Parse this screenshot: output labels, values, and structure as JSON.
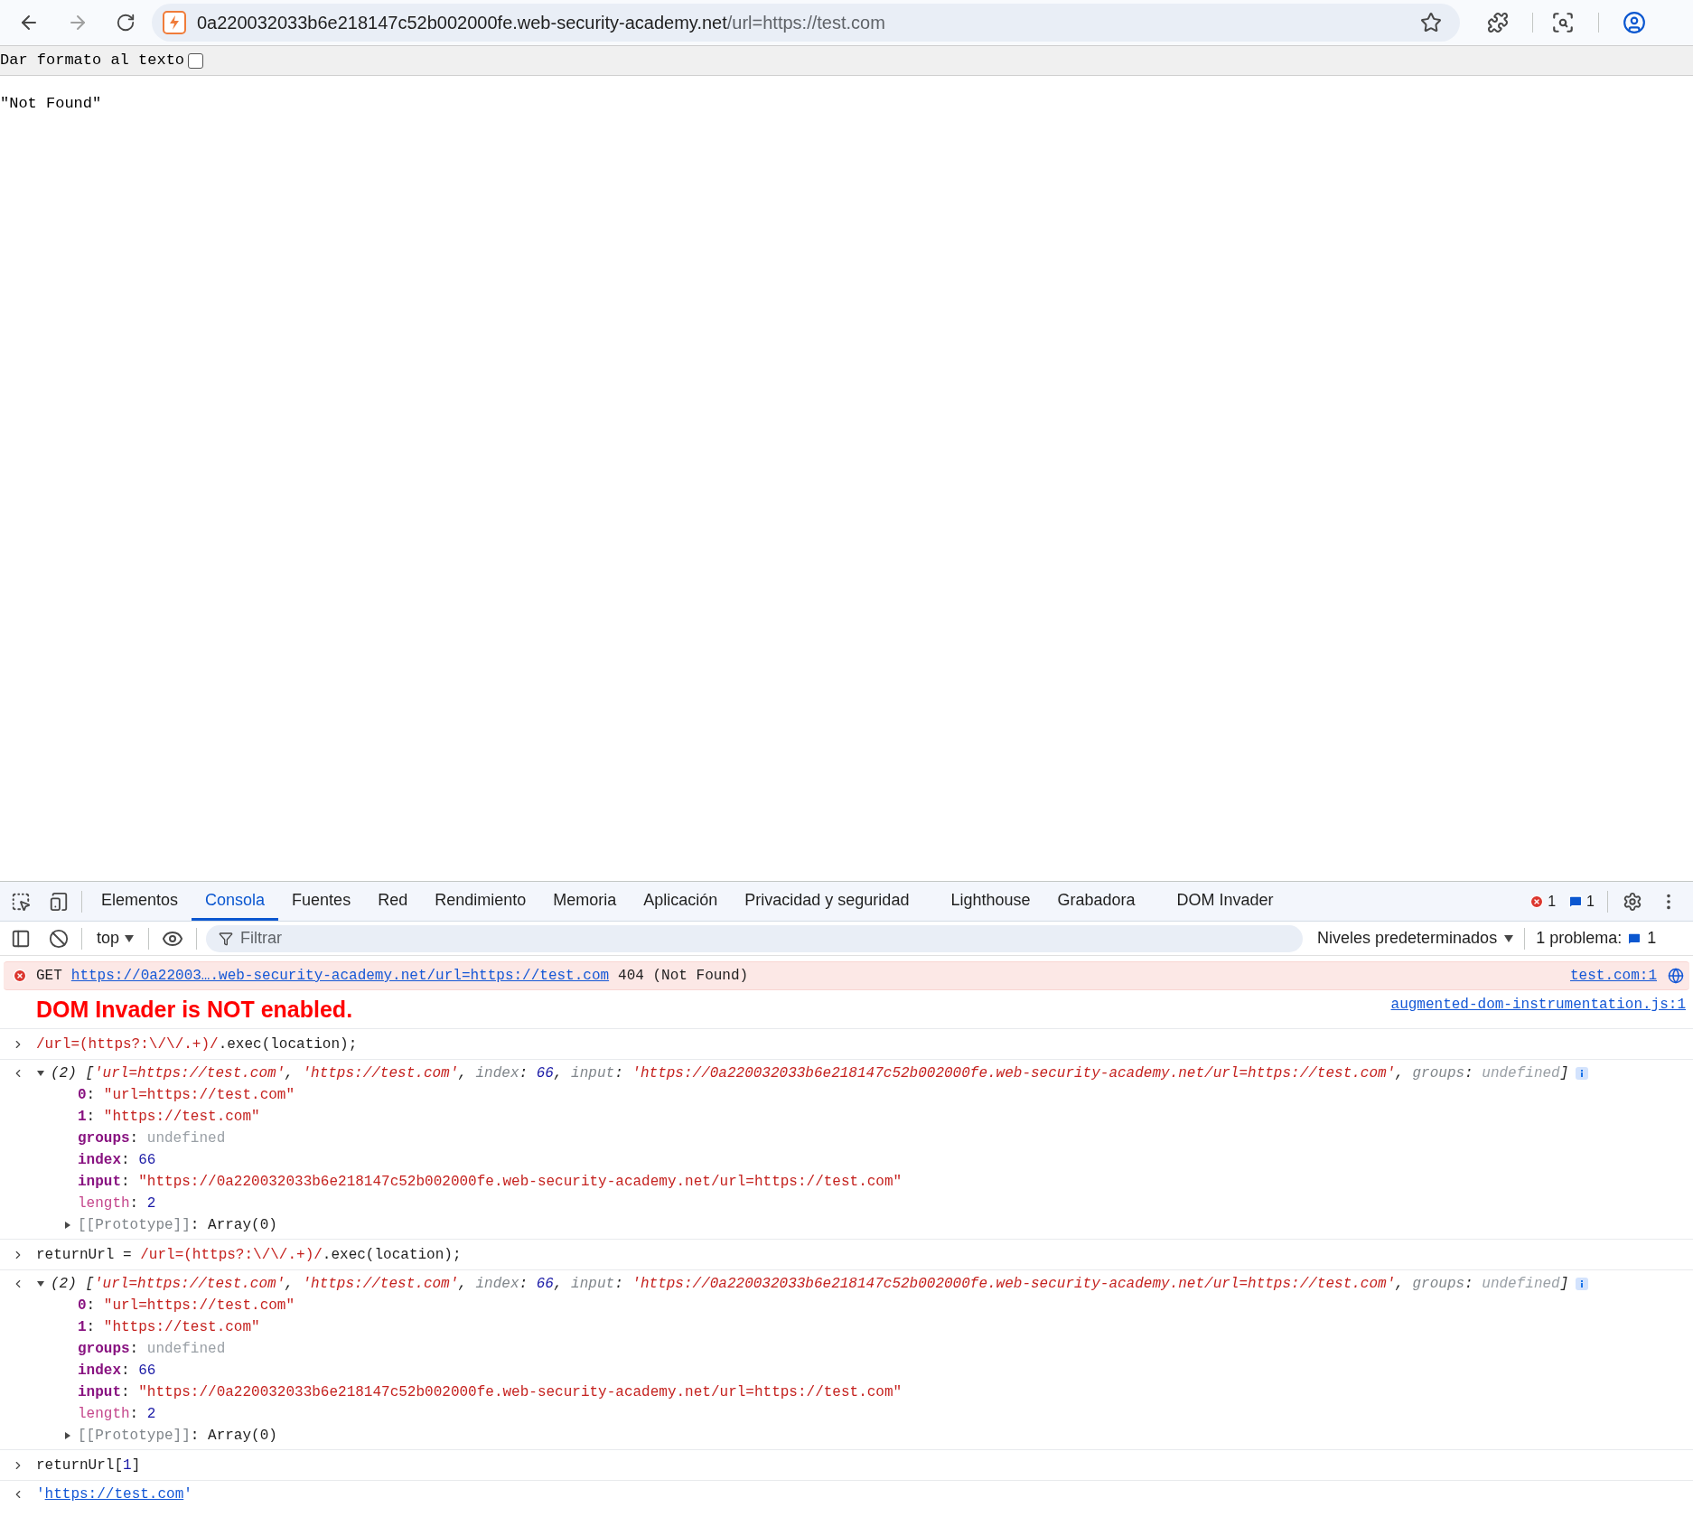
{
  "browser": {
    "url_host": "0a220032033b6e218147c52b002000fe.web-security-academy.net",
    "url_path": "/url=https://test.com"
  },
  "page": {
    "format_label": "Dar formato al texto",
    "format_checked": false,
    "body": "\"Not Found\""
  },
  "devtools": {
    "tabs": [
      {
        "label": "Elementos",
        "selected": false
      },
      {
        "label": "Consola",
        "selected": true
      },
      {
        "label": "Fuentes",
        "selected": false
      },
      {
        "label": "Red",
        "selected": false
      },
      {
        "label": "Rendimiento",
        "selected": false
      },
      {
        "label": "Memoria",
        "selected": false
      },
      {
        "label": "Aplicación",
        "selected": false
      },
      {
        "label": "Privacidad y seguridad",
        "selected": false
      },
      {
        "label": "Lighthouse",
        "selected": false
      },
      {
        "label": "Grabadora",
        "selected": false
      },
      {
        "label": "DOM Invader",
        "selected": false
      }
    ],
    "error_count": "1",
    "message_count": "1",
    "context": "top",
    "filter_placeholder": "Filtrar",
    "levels": "Niveles predeterminados",
    "issues_label": "1 problema:",
    "issues_count": "1"
  },
  "console": {
    "entries": [
      {
        "kind": "error",
        "method": "GET",
        "url": "https://0a22003….web-security-academy.net/url=https://test.com",
        "status": "404 (Not Found)",
        "source": "test.com:1"
      },
      {
        "kind": "styled_log",
        "text": "DOM Invader is NOT enabled.",
        "source": "augmented-dom-instrumentation.js:1"
      },
      {
        "kind": "input",
        "tokens": [
          {
            "kind": "regex",
            "s": "/url=(https?:\\/\\/.+)/"
          },
          {
            "kind": "plain",
            "s": ".exec(location);"
          }
        ]
      },
      {
        "kind": "array_result",
        "expanded": true,
        "summary": [
          {
            "kind": "plain",
            "s": "(2) ["
          },
          {
            "kind": "string",
            "s": "'url=https://test.com'"
          },
          {
            "kind": "plain",
            "s": ", "
          },
          {
            "kind": "string",
            "s": "'https://test.com'"
          },
          {
            "kind": "plain",
            "s": ", "
          },
          {
            "kind": "dim",
            "s": "index"
          },
          {
            "kind": "plain",
            "s": ": "
          },
          {
            "kind": "number",
            "s": "66"
          },
          {
            "kind": "plain",
            "s": ", "
          },
          {
            "kind": "dim",
            "s": "input"
          },
          {
            "kind": "plain",
            "s": ": "
          },
          {
            "kind": "string",
            "s": "'https://0a220032033b6e218147c52b002000fe.web-security-academy.net/url=https://test.com'"
          },
          {
            "kind": "plain",
            "s": ", "
          },
          {
            "kind": "dim",
            "s": "groups"
          },
          {
            "kind": "plain",
            "s": ": "
          },
          {
            "kind": "undef",
            "s": "undefined"
          },
          {
            "kind": "plain",
            "s": "]"
          }
        ],
        "properties": [
          [
            {
              "kind": "key",
              "s": "0"
            },
            {
              "kind": "plain",
              "s": ": "
            },
            {
              "kind": "string",
              "s": "\"url=https://test.com\""
            }
          ],
          [
            {
              "kind": "key",
              "s": "1"
            },
            {
              "kind": "plain",
              "s": ": "
            },
            {
              "kind": "string",
              "s": "\"https://test.com\""
            }
          ],
          [
            {
              "kind": "key",
              "s": "groups"
            },
            {
              "kind": "plain",
              "s": ": "
            },
            {
              "kind": "undef",
              "s": "undefined"
            }
          ],
          [
            {
              "kind": "key",
              "s": "index"
            },
            {
              "kind": "plain",
              "s": ": "
            },
            {
              "kind": "number",
              "s": "66"
            }
          ],
          [
            {
              "kind": "key",
              "s": "input"
            },
            {
              "kind": "plain",
              "s": ": "
            },
            {
              "kind": "string",
              "s": "\"https://0a220032033b6e218147c52b002000fe.web-security-academy.net/url=https://test.com\""
            }
          ],
          [
            {
              "kind": "hidden_key",
              "s": "length"
            },
            {
              "kind": "plain",
              "s": ": "
            },
            {
              "kind": "number",
              "s": "2"
            }
          ]
        ],
        "prototype": {
          "expanded": false,
          "tokens": [
            {
              "kind": "dim",
              "s": "[[Prototype]]"
            },
            {
              "kind": "plain",
              "s": ": Array(0)"
            }
          ]
        }
      },
      {
        "kind": "input",
        "tokens": [
          {
            "kind": "plain",
            "s": "returnUrl = "
          },
          {
            "kind": "regex",
            "s": "/url=(https?:\\/\\/.+)/"
          },
          {
            "kind": "plain",
            "s": ".exec(location);"
          }
        ]
      },
      {
        "kind": "array_result",
        "expanded": true,
        "summary": [
          {
            "kind": "plain",
            "s": "(2) ["
          },
          {
            "kind": "string",
            "s": "'url=https://test.com'"
          },
          {
            "kind": "plain",
            "s": ", "
          },
          {
            "kind": "string",
            "s": "'https://test.com'"
          },
          {
            "kind": "plain",
            "s": ", "
          },
          {
            "kind": "dim",
            "s": "index"
          },
          {
            "kind": "plain",
            "s": ": "
          },
          {
            "kind": "number",
            "s": "66"
          },
          {
            "kind": "plain",
            "s": ", "
          },
          {
            "kind": "dim",
            "s": "input"
          },
          {
            "kind": "plain",
            "s": ": "
          },
          {
            "kind": "string",
            "s": "'https://0a220032033b6e218147c52b002000fe.web-security-academy.net/url=https://test.com'"
          },
          {
            "kind": "plain",
            "s": ", "
          },
          {
            "kind": "dim",
            "s": "groups"
          },
          {
            "kind": "plain",
            "s": ": "
          },
          {
            "kind": "undef",
            "s": "undefined"
          },
          {
            "kind": "plain",
            "s": "]"
          }
        ],
        "properties": [
          [
            {
              "kind": "key",
              "s": "0"
            },
            {
              "kind": "plain",
              "s": ": "
            },
            {
              "kind": "string",
              "s": "\"url=https://test.com\""
            }
          ],
          [
            {
              "kind": "key",
              "s": "1"
            },
            {
              "kind": "plain",
              "s": ": "
            },
            {
              "kind": "string",
              "s": "\"https://test.com\""
            }
          ],
          [
            {
              "kind": "key",
              "s": "groups"
            },
            {
              "kind": "plain",
              "s": ": "
            },
            {
              "kind": "undef",
              "s": "undefined"
            }
          ],
          [
            {
              "kind": "key",
              "s": "index"
            },
            {
              "kind": "plain",
              "s": ": "
            },
            {
              "kind": "number",
              "s": "66"
            }
          ],
          [
            {
              "kind": "key",
              "s": "input"
            },
            {
              "kind": "plain",
              "s": ": "
            },
            {
              "kind": "string",
              "s": "\"https://0a220032033b6e218147c52b002000fe.web-security-academy.net/url=https://test.com\""
            }
          ],
          [
            {
              "kind": "hidden_key",
              "s": "length"
            },
            {
              "kind": "plain",
              "s": ": "
            },
            {
              "kind": "number",
              "s": "2"
            }
          ]
        ],
        "prototype": {
          "expanded": false,
          "tokens": [
            {
              "kind": "dim",
              "s": "[[Prototype]]"
            },
            {
              "kind": "plain",
              "s": ": Array(0)"
            }
          ]
        }
      },
      {
        "kind": "input",
        "tokens": [
          {
            "kind": "plain",
            "s": "returnUrl["
          },
          {
            "kind": "number",
            "s": "1"
          },
          {
            "kind": "plain",
            "s": "]"
          }
        ]
      },
      {
        "kind": "string_result",
        "quote": "'",
        "link": "https://test.com"
      }
    ]
  }
}
